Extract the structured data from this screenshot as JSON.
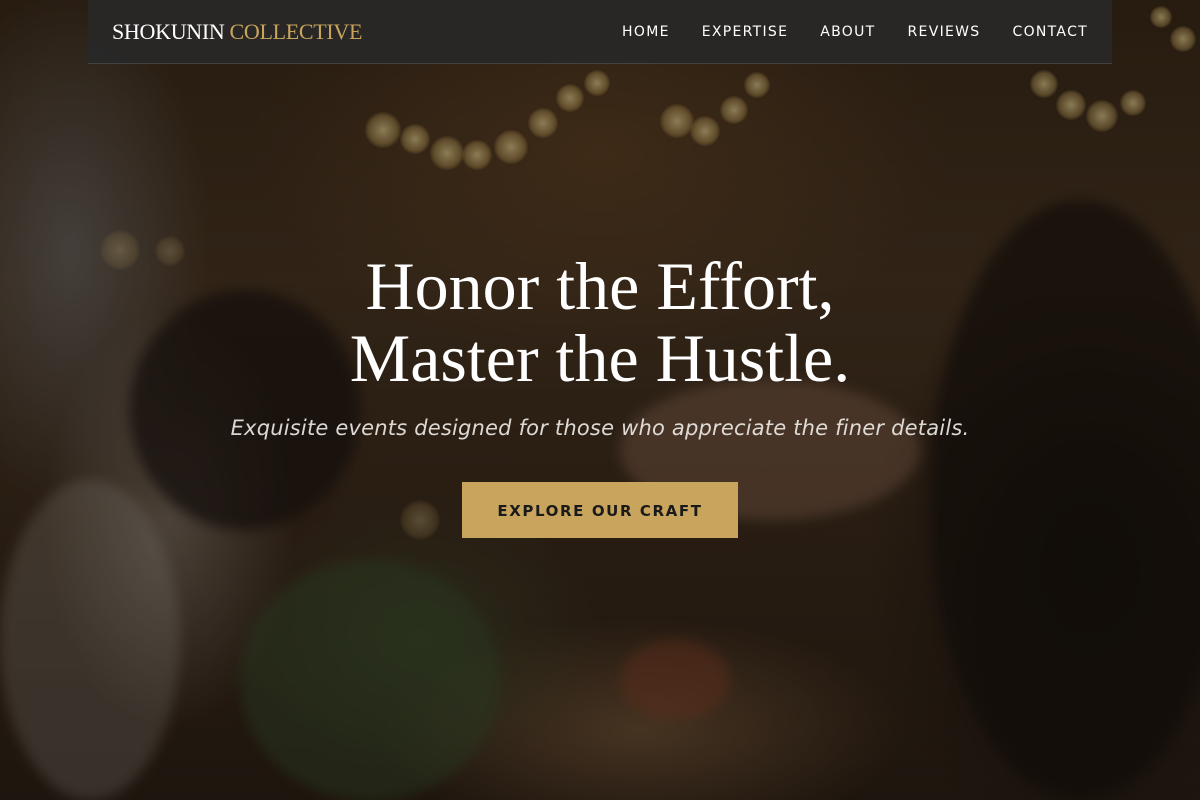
{
  "brand": {
    "name_primary": "SHOKUNIN",
    "name_secondary": "COLLECTIVE",
    "accent_color": "#c9a45c"
  },
  "nav": {
    "items": [
      {
        "label": "HOME"
      },
      {
        "label": "EXPERTISE"
      },
      {
        "label": "ABOUT"
      },
      {
        "label": "REVIEWS"
      },
      {
        "label": "CONTACT"
      }
    ]
  },
  "hero": {
    "headline_line1": "Honor the Effort,",
    "headline_line2": "Master the Hustle.",
    "subtitle": "Exquisite events designed for those who appreciate the finer details.",
    "cta_label": "EXPLORE OUR CRAFT",
    "background_description_icon": "event-photo"
  }
}
